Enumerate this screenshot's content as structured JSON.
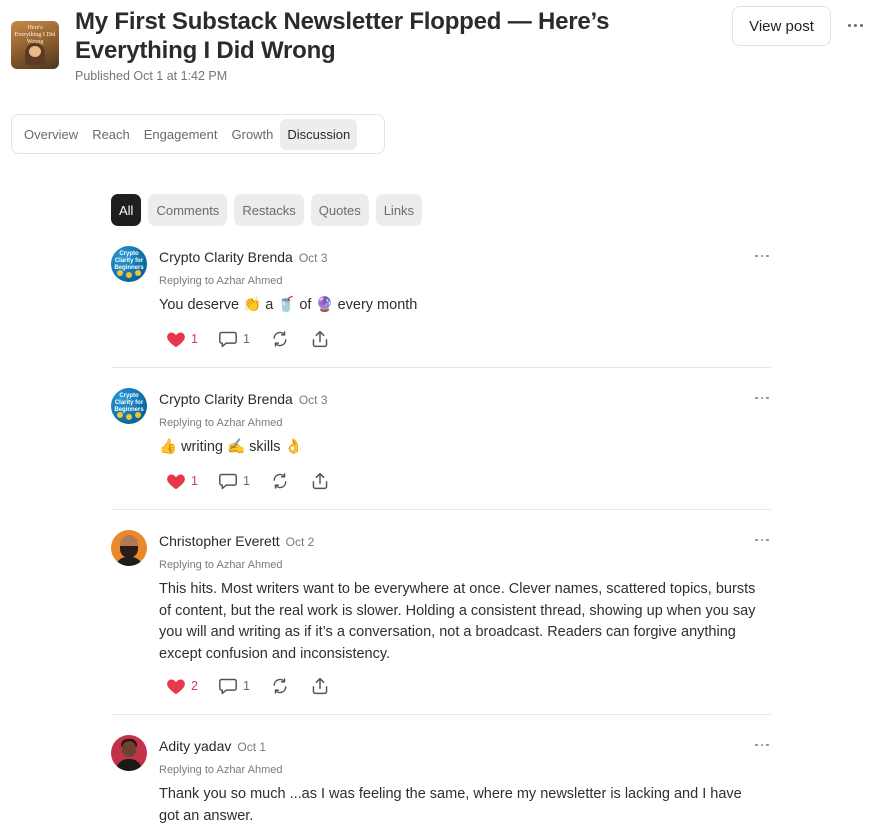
{
  "post": {
    "thumbnail_text": "Here's Everything I Did Wrong",
    "title": "My First Substack Newsletter Flopped — Here’s Everything I Did Wrong",
    "published": "Published Oct 1 at 1:42 PM",
    "view_post_label": "View post"
  },
  "tabs": [
    {
      "label": "Overview",
      "active": false
    },
    {
      "label": "Reach",
      "active": false
    },
    {
      "label": "Engagement",
      "active": false
    },
    {
      "label": "Growth",
      "active": false
    },
    {
      "label": "Discussion",
      "active": true
    }
  ],
  "filters": [
    {
      "label": "All",
      "active": true
    },
    {
      "label": "Comments",
      "active": false
    },
    {
      "label": "Restacks",
      "active": false
    },
    {
      "label": "Quotes",
      "active": false
    },
    {
      "label": "Links",
      "active": false
    }
  ],
  "comments": [
    {
      "author": "Crypto Clarity Brenda",
      "avatar_text": "Crypto Clarity for Beginners",
      "date": "Oct 3",
      "replying_to": "Replying to Azhar Ahmed",
      "text": "You deserve 👏 a 🥤 of 🔮 every month",
      "likes": "1",
      "replies": "1"
    },
    {
      "author": "Crypto Clarity Brenda",
      "avatar_text": "Crypto Clarity for Beginners",
      "date": "Oct 3",
      "replying_to": "Replying to Azhar Ahmed",
      "text": "👍 writing ✍️ skills 👌",
      "likes": "1",
      "replies": "1"
    },
    {
      "author": "Christopher Everett",
      "date": "Oct 2",
      "replying_to": "Replying to Azhar Ahmed",
      "text": "This hits. Most writers want to be everywhere at once. Clever names, scattered topics, bursts of content, but the real work is slower. Holding a consistent thread, showing up when you say you will and writing as if it’s a conversation, not a broadcast. Readers can forgive anything except confusion and inconsistency.",
      "likes": "2",
      "replies": "1"
    },
    {
      "author": "Adity yadav",
      "date": "Oct 1",
      "replying_to": "Replying to Azhar Ahmed",
      "text": "Thank you so much ...as I was feeling the same, where my newsletter is lacking and I have got an answer."
    }
  ],
  "colors": {
    "heart": "#e5394a",
    "active_chip": "#1f1f1f",
    "tab_active_bg": "#ededed"
  },
  "icons": [
    "heart-icon",
    "comment-icon",
    "restack-icon",
    "share-icon",
    "more-icon"
  ]
}
